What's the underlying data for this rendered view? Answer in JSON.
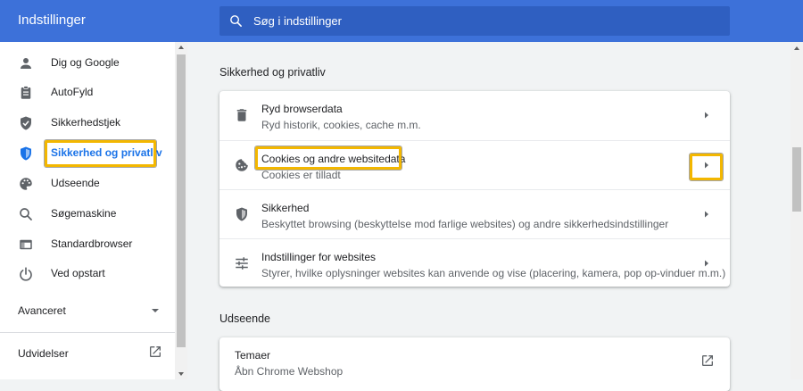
{
  "header": {
    "title": "Indstillinger",
    "search_placeholder": "Søg i indstillinger",
    "search_icon": "search-icon"
  },
  "sidebar": {
    "items": [
      {
        "label": "Dig og Google",
        "icon": "person-icon"
      },
      {
        "label": "AutoFyld",
        "icon": "clipboard-icon"
      },
      {
        "label": "Sikkerhedstjek",
        "icon": "shield-check-icon"
      },
      {
        "label": "Sikkerhed og privatliv",
        "icon": "shield-icon",
        "active": true
      },
      {
        "label": "Udseende",
        "icon": "palette-icon"
      },
      {
        "label": "Søgemaskine",
        "icon": "search-icon"
      },
      {
        "label": "Standardbrowser",
        "icon": "browser-icon"
      },
      {
        "label": "Ved opstart",
        "icon": "power-icon"
      }
    ],
    "advanced_label": "Avanceret",
    "extensions_label": "Udvidelser"
  },
  "main": {
    "privacy_section_title": "Sikkerhed og privatliv",
    "privacy_rows": [
      {
        "title": "Ryd browserdata",
        "subtitle": "Ryd historik, cookies, cache m.m.",
        "icon": "trash-icon"
      },
      {
        "title": "Cookies og andre websitedata",
        "subtitle": "Cookies er tilladt",
        "icon": "cookie-icon"
      },
      {
        "title": "Sikkerhed",
        "subtitle": "Beskyttet browsing (beskyttelse mod farlige websites) og andre sikkerhedsindstillinger",
        "icon": "shield-icon"
      },
      {
        "title": "Indstillinger for websites",
        "subtitle": "Styrer, hvilke oplysninger websites kan anvende og vise (placering, kamera, pop op-vinduer m.m.)",
        "icon": "sliders-icon"
      }
    ],
    "appearance_section_title": "Udseende",
    "appearance_rows": [
      {
        "title": "Temaer",
        "subtitle": "Åbn Chrome Webshop",
        "icon": "external-link-icon"
      }
    ]
  },
  "colors": {
    "header_bg": "#3d71d9",
    "accent": "#1a73e8",
    "highlight": "#f3b700"
  }
}
